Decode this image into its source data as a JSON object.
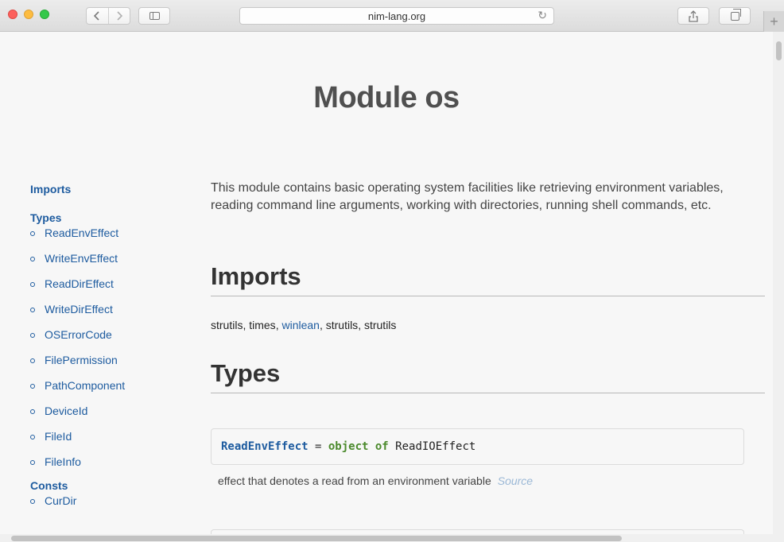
{
  "browser": {
    "url": "nim-lang.org",
    "back_icon": "chevron-left-icon",
    "forward_icon": "chevron-right-icon",
    "reload_glyph": "↻",
    "share_glyph": "⇪",
    "new_tab_glyph": "+"
  },
  "page": {
    "title": "Module os",
    "intro": "This module contains basic operating system facilities like retrieving environment variables, reading command line arguments, working with directories, running shell commands, etc."
  },
  "nav": {
    "imports_heading": "Imports",
    "types_heading": "Types",
    "types": [
      "ReadEnvEffect",
      "WriteEnvEffect",
      "ReadDirEffect",
      "WriteDirEffect",
      "OSErrorCode",
      "FilePermission",
      "PathComponent",
      "DeviceId",
      "FileId",
      "FileInfo"
    ],
    "consts_heading": "Consts",
    "consts": [
      "CurDir"
    ]
  },
  "imports": {
    "heading": "Imports",
    "items": [
      {
        "text": "strutils",
        "link": false
      },
      {
        "text": "times",
        "link": false
      },
      {
        "text": "winlean",
        "link": true
      },
      {
        "text": "strutils",
        "link": false
      },
      {
        "text": "strutils",
        "link": false
      }
    ],
    "separator": ", "
  },
  "types_section": {
    "heading": "Types",
    "first_type": {
      "name": "ReadEnvEffect",
      "eq": " = ",
      "keyword": "object of",
      "base": " ReadIOEffect",
      "description": "effect that denotes a read from an environment variable",
      "source_label": "Source"
    }
  },
  "colors": {
    "link": "#1d5b9f",
    "keyword": "#4b8a2c",
    "title": "#505050"
  }
}
